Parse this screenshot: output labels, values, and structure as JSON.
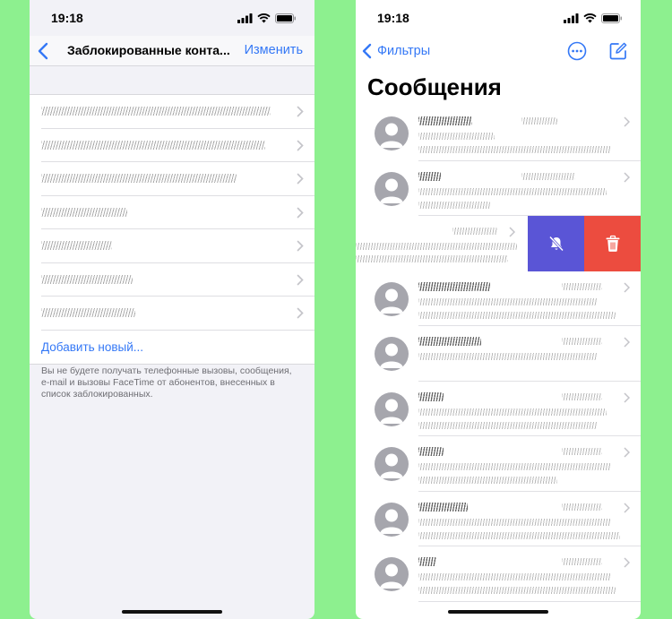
{
  "left": {
    "status": {
      "time": "19:18"
    },
    "nav": {
      "title": "Заблокированные конта...",
      "action": "Изменить"
    },
    "blocked_rows": [
      {
        "w": 0.88
      },
      {
        "w": 0.86
      },
      {
        "w": 0.75
      },
      {
        "w": 0.33
      },
      {
        "w": 0.27
      },
      {
        "w": 0.35
      },
      {
        "w": 0.36
      }
    ],
    "add_new": "Добавить новый...",
    "footer": "Вы не будете получать телефонные вызовы, сообщения, e-mail и вызовы FaceTime от абонентов, внесенных в список заблокированных."
  },
  "right": {
    "status": {
      "time": "19:18"
    },
    "nav": {
      "back": "Фильтры"
    },
    "title": "Сообщения",
    "colors": {
      "accent": "#3478f6",
      "mute": "#5a55d6",
      "delete": "#ec4c3f"
    }
  }
}
